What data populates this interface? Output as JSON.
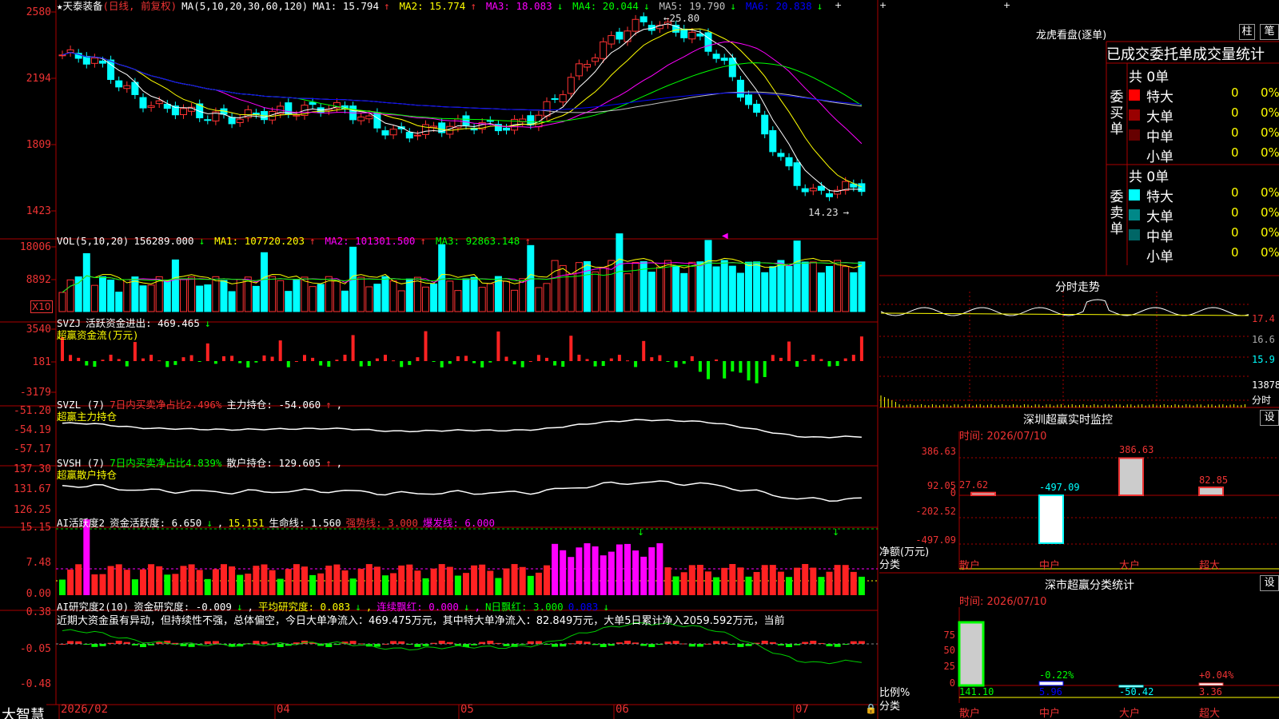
{
  "app": {
    "brand": "大智慧",
    "lock_icon": "lock-icon"
  },
  "main_header": {
    "name": "★天泰装备",
    "period": "(日线, 前复权)",
    "ma_params": "MA(5,10,20,30,60,120)",
    "items": [
      {
        "t": "MA1: 15.794",
        "arrow": "↑",
        "c": "#ffffff"
      },
      {
        "t": "MA2: 15.774",
        "arrow": "↑",
        "c": "#ffff00"
      },
      {
        "t": "MA3: 18.083",
        "arrow": "↓",
        "c": "#ff00ff"
      },
      {
        "t": "MA4: 20.044",
        "arrow": "↓",
        "c": "#00ff00"
      },
      {
        "t": "MA5: 19.790",
        "arrow": "↓",
        "c": "#c0c0c0"
      },
      {
        "t": "MA6: 20.838",
        "arrow": "↓",
        "c": "#0000ff"
      }
    ],
    "high_label": "25.80",
    "low_label": "14.23"
  },
  "y_axes": {
    "price": [
      "2580",
      "2194",
      "1809",
      "1423"
    ],
    "vol": [
      "18006",
      "8892"
    ],
    "vol_unit": "X10",
    "svzj": [
      "3540",
      "181",
      "-3179"
    ],
    "svzl": [
      "-51.20",
      "-54.19",
      "-57.17"
    ],
    "svsh": [
      "137.30",
      "131.67",
      "126.25"
    ],
    "ai1": [
      "15.15",
      "7.48",
      "0.00"
    ],
    "ai2": [
      "0.38",
      "-0.05",
      "-0.48"
    ]
  },
  "x_axis": [
    "2026/02",
    "04",
    "05",
    "06",
    "07"
  ],
  "vol_header": {
    "params": "VOL(5,10,20)",
    "value": "156289.000",
    "arrow": "↓",
    "items": [
      {
        "t": "MA1: 107720.203",
        "arrow": "↑",
        "c": "#ffff00"
      },
      {
        "t": "MA2: 101301.500",
        "arrow": "↑",
        "c": "#ff00ff"
      },
      {
        "t": "MA3: 92863.148",
        "arrow": "↑",
        "c": "#00ff00"
      }
    ]
  },
  "svzj_header": {
    "name": "SVZJ",
    "label": "活跃资金进出: 469.465",
    "arrow": "↓",
    "sub": "超赢资金流(万元)"
  },
  "svzl_header": {
    "name": "SVZL (7)",
    "ratio": "7日内买卖净占比2.496%",
    "label": "主力持仓: -54.060",
    "arrow": "↑",
    "sub": "超赢主力持仓"
  },
  "svsh_header": {
    "name": "SVSH (7)",
    "ratio": "7日内买卖净占比4.839%",
    "label": "散户持仓: 129.605",
    "arrow": "↑",
    "sub": "超赢散户持仓"
  },
  "ai1_header": {
    "name": "AI活跃度2",
    "a": "资金活跃度: 6.650",
    "a_arrow": "↓",
    "b": "15.151",
    "c": "生命线: 1.560",
    "d": "强势线: 3.000",
    "e": "爆发线: 6.000"
  },
  "ai2_header": {
    "name": "AI研究度2(10)",
    "a": "资金研究度: -0.009",
    "a_arrow": "↓",
    "b": "平均研究度: 0.083",
    "b_arrow": "↓",
    "c": "连续飘红: 0.000",
    "c_arrow": "↓",
    "d": "N日飘红: 3.000",
    "e": "0.083",
    "e_arrow": "↓",
    "summary": "近期大资金虽有异动，但持续性不强，总体偏空，今日大单净流入：469.475万元，其中特大单净流入：82.849万元，大单5日累计净入2059.592万元，当前"
  },
  "dragon": {
    "title": "龙虎看盘(逐单)",
    "btn1": "柱",
    "btn2": "笔",
    "subtitle": "已成交委托单成交量统计",
    "buy": {
      "label": "委买单",
      "total": "共 0单",
      "rows": [
        {
          "name": "特大",
          "qty": "0",
          "pct": "0%",
          "color": "#ff0000"
        },
        {
          "name": "大单",
          "qty": "0",
          "pct": "0%",
          "color": "#990000"
        },
        {
          "name": "中单",
          "qty": "0",
          "pct": "0%",
          "color": "#660000"
        },
        {
          "name": "小单",
          "qty": "0",
          "pct": "0%",
          "color": "#000000"
        }
      ]
    },
    "sell": {
      "label": "委卖单",
      "total": "共 0单",
      "rows": [
        {
          "name": "特大",
          "qty": "0",
          "pct": "0%",
          "color": "#00ffff"
        },
        {
          "name": "大单",
          "qty": "0",
          "pct": "0%",
          "color": "#008888"
        },
        {
          "name": "中单",
          "qty": "0",
          "pct": "0%",
          "color": "#006666"
        },
        {
          "name": "小单",
          "qty": "0",
          "pct": "0%",
          "color": "#000000"
        }
      ]
    }
  },
  "intraday": {
    "title": "分时走势",
    "labels": [
      "17.4",
      "16.6",
      "15.9",
      "13878"
    ],
    "unit": "分时"
  },
  "monitor": {
    "title": "深圳超赢实时监控",
    "settings": "设",
    "time": "时间: 2026/07/10",
    "yticks": [
      "386.63",
      "92.05",
      "0",
      "-202.52",
      "-497.09"
    ],
    "ylabel": "净额(万元)",
    "xlabel": "分类",
    "chart_data": {
      "type": "bar",
      "categories": [
        "散户",
        "中户",
        "大户",
        "超大"
      ],
      "values": [
        27.62,
        -497.09,
        386.63,
        82.85
      ],
      "ylim": [
        -497.09,
        386.63
      ]
    }
  },
  "stats": {
    "title": "深市超赢分类统计",
    "settings": "设",
    "time": "时间: 2026/07/10",
    "yticks": [
      "75",
      "50",
      "25",
      "0"
    ],
    "ylabel": "比例%",
    "xlabel": "分类",
    "chart_data": {
      "type": "bar",
      "categories": [
        "散户",
        "中户",
        "大户",
        "超大"
      ],
      "pct": [
        "",
        "-0.22%",
        "",
        "+0.04%"
      ],
      "values": [
        141.1,
        5.96,
        -50.42,
        3.36
      ]
    }
  }
}
